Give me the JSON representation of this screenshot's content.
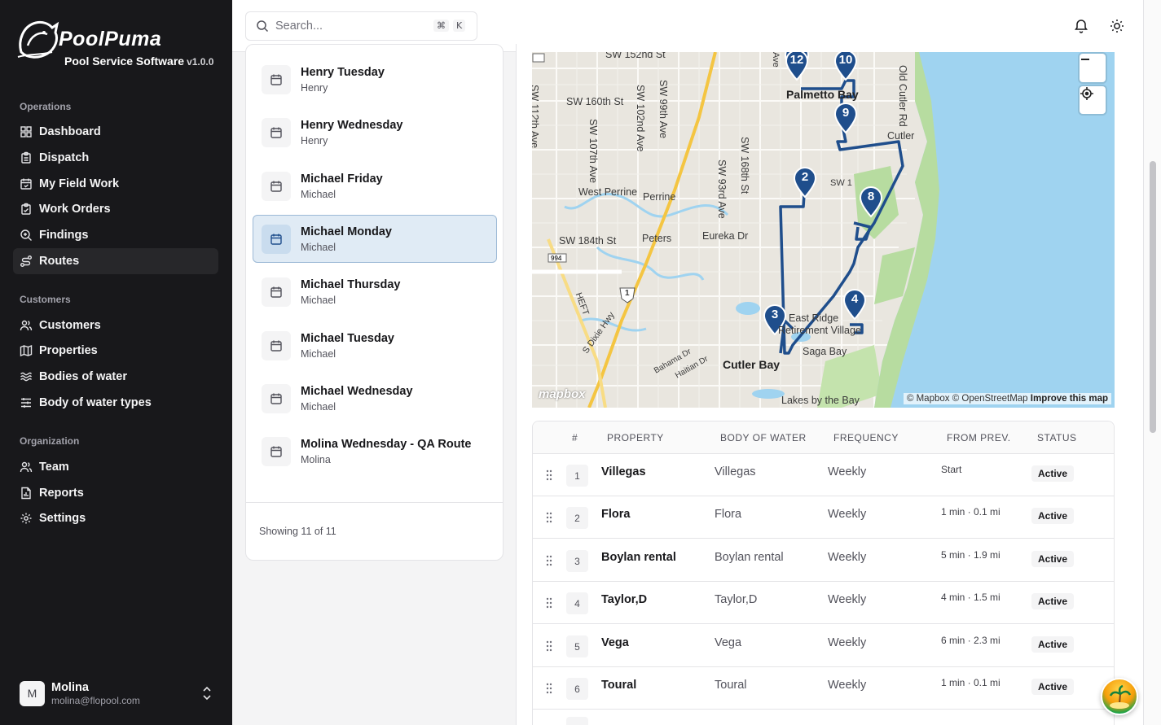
{
  "brand": {
    "name": "PoolPuma",
    "subtitle": "Pool Service Software",
    "version": "v1.0.0"
  },
  "sidebar": {
    "sections": [
      {
        "title": "Operations",
        "items": [
          {
            "label": "Dashboard",
            "icon": "dashboard-icon"
          },
          {
            "label": "Dispatch",
            "icon": "clipboard-icon"
          },
          {
            "label": "My Field Work",
            "icon": "calendar-check-icon"
          },
          {
            "label": "Work Orders",
            "icon": "clipboard-check-icon"
          },
          {
            "label": "Findings",
            "icon": "search-zoom-icon"
          },
          {
            "label": "Routes",
            "icon": "route-icon",
            "active": true
          }
        ]
      },
      {
        "title": "Customers",
        "items": [
          {
            "label": "Customers",
            "icon": "users-icon"
          },
          {
            "label": "Properties",
            "icon": "map-icon"
          },
          {
            "label": "Bodies of water",
            "icon": "waves-icon"
          },
          {
            "label": "Body of water types",
            "icon": "sliders-icon"
          }
        ]
      },
      {
        "title": "Organization",
        "items": [
          {
            "label": "Team",
            "icon": "team-icon"
          },
          {
            "label": "Reports",
            "icon": "report-icon"
          },
          {
            "label": "Settings",
            "icon": "gear-icon"
          }
        ]
      }
    ],
    "user": {
      "initial": "M",
      "name": "Molina",
      "email": "molina@flopool.com"
    }
  },
  "topbar": {
    "search_placeholder": "Search...",
    "shortcut_mod": "⌘",
    "shortcut_key": "K"
  },
  "routes": {
    "items": [
      {
        "name": "Henry Tuesday",
        "tech": "Henry"
      },
      {
        "name": "Henry Wednesday",
        "tech": "Henry"
      },
      {
        "name": "Michael Friday",
        "tech": "Michael"
      },
      {
        "name": "Michael Monday",
        "tech": "Michael",
        "active": true
      },
      {
        "name": "Michael Thursday",
        "tech": "Michael"
      },
      {
        "name": "Michael Tuesday",
        "tech": "Michael"
      },
      {
        "name": "Michael Wednesday",
        "tech": "Michael"
      },
      {
        "name": "Molina Wednesday - QA Route",
        "tech": "Molina"
      }
    ],
    "count_text": "Showing 11 of 11"
  },
  "map": {
    "attribution": "© Mapbox © OpenStreetMap",
    "improve": "Improve this map",
    "logo": "mapbox",
    "markers": [
      "12",
      "10",
      "9",
      "2",
      "8",
      "3",
      "4"
    ],
    "labels": [
      "SW 152nd St",
      "Palmetto Bay",
      "Cutler",
      "SW 160th St",
      "SW 112th Ave",
      "SW 107th Ave",
      "SW 102nd Ave",
      "SW 99th Ave",
      "SW 168th St",
      "SW 93rd Ave",
      "Old Cutler Rd",
      "West Perrine",
      "Perrine",
      "Eureka Dr",
      "SW 184th St",
      "Peters",
      "994",
      "1",
      "HEFT",
      "S Dixie Hwy",
      "East Ridge",
      "Retirement Village",
      "Saga Bay",
      "Cutler Bay",
      "Bahama Dr",
      "Haitian Dr",
      "Lakes by the Bay",
      "SW 1",
      "Ave"
    ],
    "colors": {
      "route": "#1f4e8c",
      "water": "#9fd3f0",
      "park": "#b7dca0",
      "land": "#e9e6df",
      "highway": "#f4c542"
    }
  },
  "table": {
    "headers": [
      "#",
      "PROPERTY",
      "BODY OF WATER",
      "FREQUENCY",
      "FROM PREV.",
      "STATUS"
    ],
    "rows": [
      {
        "num": "1",
        "property": "Villegas",
        "body": "Villegas",
        "frequency": "Weekly",
        "from_prev": "Start",
        "status": "Active"
      },
      {
        "num": "2",
        "property": "Flora",
        "body": "Flora",
        "frequency": "Weekly",
        "from_prev": "1 min · 0.1 mi",
        "status": "Active"
      },
      {
        "num": "3",
        "property": "Boylan rental",
        "body": "Boylan rental",
        "frequency": "Weekly",
        "from_prev": "5 min · 1.9 mi",
        "status": "Active"
      },
      {
        "num": "4",
        "property": "Taylor,D",
        "body": "Taylor,D",
        "frequency": "Weekly",
        "from_prev": "4 min · 1.5 mi",
        "status": "Active"
      },
      {
        "num": "5",
        "property": "Vega",
        "body": "Vega",
        "frequency": "Weekly",
        "from_prev": "6 min · 2.3 mi",
        "status": "Active"
      },
      {
        "num": "6",
        "property": "Toural",
        "body": "Toural",
        "frequency": "Weekly",
        "from_prev": "1 min · 0.1 mi",
        "status": "Active"
      }
    ]
  }
}
